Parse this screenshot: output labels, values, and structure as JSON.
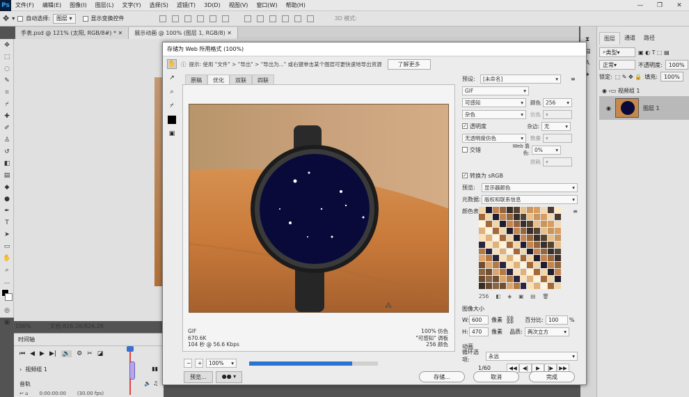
{
  "menubar": {
    "logo": "Ps",
    "items": [
      "文件(F)",
      "编辑(E)",
      "图像(I)",
      "图层(L)",
      "文字(Y)",
      "选择(S)",
      "滤镜(T)",
      "3D(D)",
      "视图(V)",
      "窗口(W)",
      "帮助(H)"
    ],
    "win_controls": [
      "—",
      "❐",
      "✕"
    ]
  },
  "options_bar": {
    "auto_select_label": "自动选择:",
    "layer_select": "图层",
    "transform_label": "显示变换控件",
    "mode_3d": "3D 模式:"
  },
  "doc_tabs": [
    {
      "label": "手表.psd @ 121% (太阳, RGB/8#) *",
      "active": false
    },
    {
      "label": "展示动画 @ 100% (图层 1, RGB/8)",
      "active": true
    }
  ],
  "status": {
    "zoom": "100%",
    "doc_size": "文档:826.2K/826.2K"
  },
  "timeline": {
    "title": "时间轴",
    "group": "视频组 1",
    "audio": "音轨",
    "timecode": "0:00:00:00",
    "fps": "(30.00 fps)"
  },
  "right_panel": {
    "tabs": [
      "图层",
      "通道",
      "路径"
    ],
    "kind_label": "类型",
    "blend_mode": "正常",
    "opacity_label": "不透明度:",
    "opacity": "100%",
    "lock_label": "锁定:",
    "fill_label": "填充:",
    "fill": "100%",
    "layers": [
      "视频组 1",
      "图层 1"
    ]
  },
  "dialog": {
    "title": "存储为 Web 所用格式 (100%)",
    "hint": "提示: 使用 \"文件\" > \"导出\" > \"导出为...\" 或右键单击某个图层可更快速地导出资源",
    "learn_more": "了解更多",
    "view_tabs": [
      "原稿",
      "优化",
      "双联",
      "四联"
    ],
    "active_view": "优化",
    "info_left": [
      "GIF",
      "670.6K",
      "104 秒 @ 56.6 Kbps"
    ],
    "info_right": [
      "100% 仿色",
      "\"可感知\" 调板",
      "256 颜色"
    ],
    "zoom": "100%",
    "progress": 0.8,
    "preview_btn": "预览...",
    "save_btn": "存储...",
    "cancel_btn": "取消",
    "done_btn": "完成",
    "settings": {
      "preset_label": "预设:",
      "preset": "[未命名]",
      "format": "GIF",
      "reduction": "可感知",
      "colors_label": "颜色",
      "colors": "256",
      "dither_algo": "杂色",
      "dither_label": "仿色",
      "transparency": "透明度",
      "matte_label": "杂边:",
      "matte": "无",
      "trans_dither": "无透明度仿色",
      "amount_label": "数量",
      "interlaced": "交错",
      "web_snap_label": "Web 靠色:",
      "web_snap": "0%",
      "lossy_label": "损耗",
      "convert_srgb": "转换为 sRGB",
      "preview_label": "预览:",
      "preview_value": "显示器颜色",
      "metadata_label": "元数据:",
      "metadata_value": "版权和联系信息",
      "color_table_label": "颜色表",
      "color_count": "256",
      "image_size_label": "图像大小",
      "w_label": "W:",
      "w": "600",
      "h_label": "H:",
      "h": "470",
      "unit": "像素",
      "percent_label": "百分比:",
      "percent": "100",
      "pct_sign": "%",
      "quality_label": "品质:",
      "quality": "两次立方",
      "animation_label": "动画",
      "loop_label": "循环选项:",
      "loop": "永远",
      "frame": "1/60"
    }
  },
  "colors": {
    "accent": "#2a73d2",
    "watch_face": "#0a0a3a"
  }
}
